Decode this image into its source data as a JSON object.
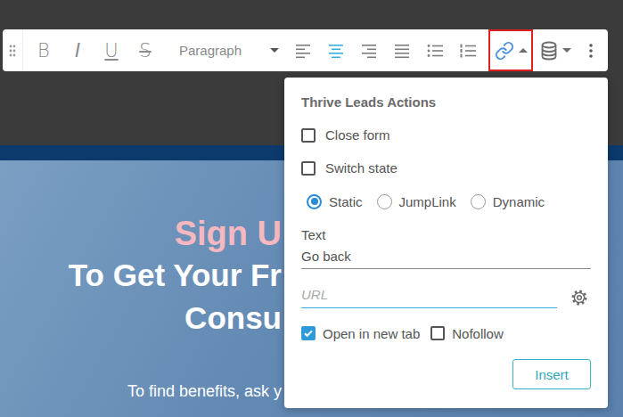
{
  "toolbar": {
    "format_buttons": [
      {
        "label": "B",
        "kind": "bold"
      },
      {
        "label": "I",
        "kind": "italic"
      },
      {
        "label": "U",
        "kind": "underline"
      },
      {
        "label": "S",
        "kind": "strike"
      }
    ],
    "block_format": {
      "value": "Paragraph"
    },
    "alignment": [
      {
        "kind": "left",
        "selected": false
      },
      {
        "kind": "center",
        "selected": true
      },
      {
        "kind": "right",
        "selected": false
      },
      {
        "kind": "justify",
        "selected": false
      }
    ],
    "lists": [
      {
        "kind": "bullets"
      },
      {
        "kind": "numbers"
      }
    ],
    "link_button": {
      "highlighted": true,
      "expanded": true
    },
    "data_button": {
      "expanded": false
    }
  },
  "popup": {
    "title": "Thrive Leads Actions",
    "actions": [
      {
        "label": "Close form",
        "checked": false
      },
      {
        "label": "Switch state",
        "checked": false
      }
    ],
    "link_types": [
      {
        "label": "Static",
        "selected": true
      },
      {
        "label": "JumpLink",
        "selected": false
      },
      {
        "label": "Dynamic",
        "selected": false
      }
    ],
    "text_field": {
      "label": "Text",
      "value": "Go back"
    },
    "url_field": {
      "placeholder": "URL",
      "focused": true
    },
    "options": [
      {
        "label": "Open in new tab",
        "checked": true
      },
      {
        "label": "Nofollow",
        "checked": false
      }
    ],
    "button": "Insert"
  },
  "hero": {
    "headline": "Sign U",
    "lines": [
      "To Get Your Fr",
      "Consu"
    ],
    "body": "To find benefits, ask y"
  }
}
